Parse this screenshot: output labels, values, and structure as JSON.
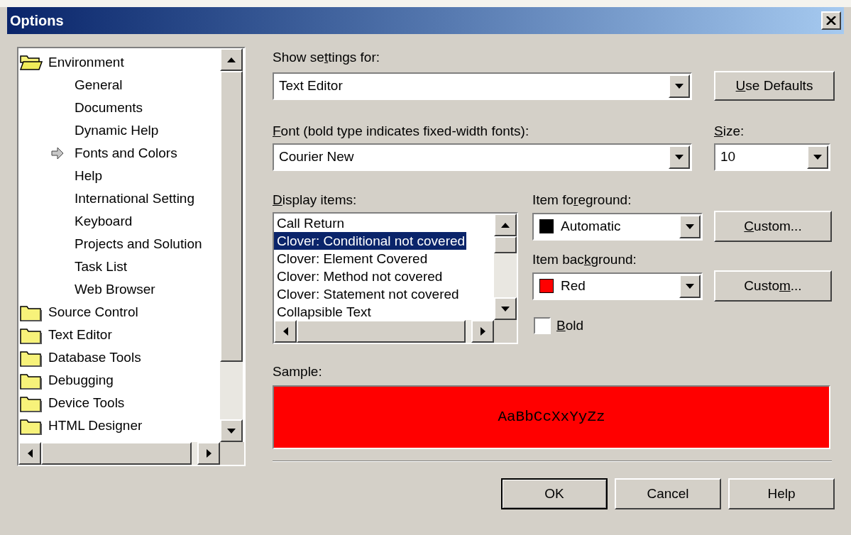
{
  "window": {
    "title": "Options"
  },
  "tree": {
    "items": [
      {
        "label": "Environment",
        "expanded": true,
        "selected": false,
        "children": [
          {
            "label": "General",
            "selected": false
          },
          {
            "label": "Documents",
            "selected": false
          },
          {
            "label": "Dynamic Help",
            "selected": false
          },
          {
            "label": "Fonts and Colors",
            "selected": true
          },
          {
            "label": "Help",
            "selected": false
          },
          {
            "label": "International Setting",
            "selected": false
          },
          {
            "label": "Keyboard",
            "selected": false
          },
          {
            "label": "Projects and Solution",
            "selected": false
          },
          {
            "label": "Task List",
            "selected": false
          },
          {
            "label": "Web Browser",
            "selected": false
          }
        ]
      },
      {
        "label": "Source Control",
        "expanded": false,
        "selected": false
      },
      {
        "label": "Text Editor",
        "expanded": false,
        "selected": false
      },
      {
        "label": "Database Tools",
        "expanded": false,
        "selected": false
      },
      {
        "label": "Debugging",
        "expanded": false,
        "selected": false
      },
      {
        "label": "Device Tools",
        "expanded": false,
        "selected": false
      },
      {
        "label": "HTML Designer",
        "expanded": false,
        "selected": false
      }
    ]
  },
  "show_settings_for": {
    "label": {
      "before": "Show se",
      "key": "t",
      "after": "tings for:"
    },
    "value": "Text Editor"
  },
  "use_defaults": {
    "label": {
      "key": "U",
      "after": "se Defaults"
    }
  },
  "font": {
    "label": {
      "key": "F",
      "after": "ont (bold type indicates fixed-width fonts):"
    },
    "value": "Courier New"
  },
  "size": {
    "label": {
      "key": "S",
      "after": "ize:"
    },
    "value": "10"
  },
  "display_items": {
    "label": {
      "key": "D",
      "after": "isplay items:"
    },
    "items": [
      {
        "text": "Call Return",
        "selected": false
      },
      {
        "text": "Clover: Conditional not covered",
        "selected": true
      },
      {
        "text": "Clover: Element Covered",
        "selected": false
      },
      {
        "text": "Clover: Method not covered",
        "selected": false
      },
      {
        "text": "Clover: Statement not covered",
        "selected": false
      },
      {
        "text": "Collapsible Text",
        "selected": false
      }
    ]
  },
  "item_foreground": {
    "label": {
      "before": "Item fo",
      "key": "r",
      "after": "eground:"
    },
    "value": "Automatic",
    "color": "#000000",
    "button": {
      "key": "C",
      "after": "ustom..."
    }
  },
  "item_background": {
    "label": {
      "before": "Item bac",
      "key": "k",
      "after": "ground:"
    },
    "value": "Red",
    "color": "#ff0000",
    "button": {
      "before": "Custo",
      "key": "m",
      "after": "..."
    }
  },
  "bold": {
    "label": {
      "key": "B",
      "after": "old"
    },
    "checked": false
  },
  "sample": {
    "label": "Sample:",
    "text": "AaBbCcXxYyZz"
  },
  "buttons": [
    {
      "label": "OK",
      "default": true
    },
    {
      "label": "Cancel",
      "default": false
    },
    {
      "label": "Help",
      "default": false
    }
  ]
}
